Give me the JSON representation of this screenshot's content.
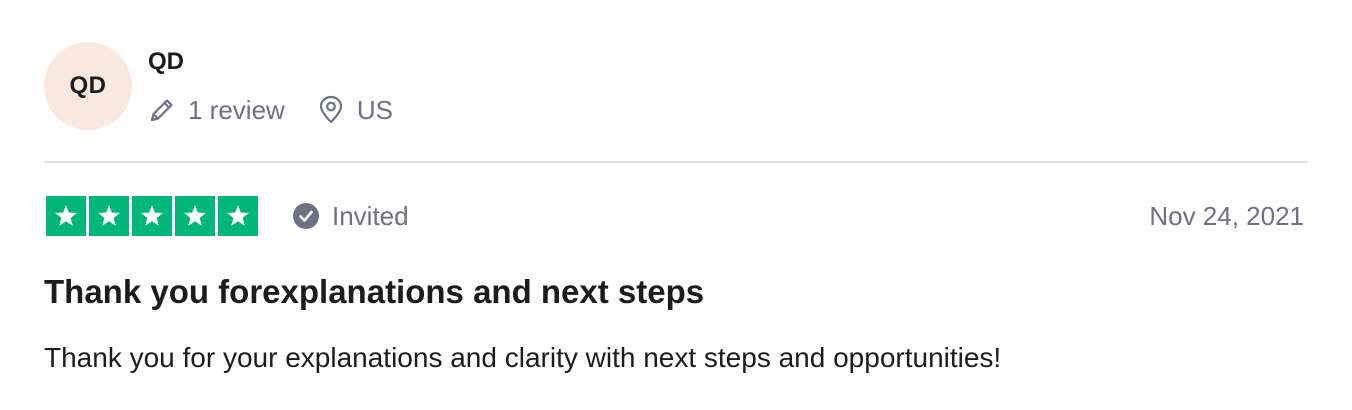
{
  "reviewer": {
    "initials": "QD",
    "name": "QD",
    "review_count": "1 review",
    "location": "US",
    "avatar_bg": "#f9e8de"
  },
  "rating": {
    "stars": 5,
    "max_stars": 5,
    "star_color": "#00b67a",
    "verification_label": "Invited"
  },
  "review": {
    "date": "Nov 24, 2021",
    "title": "Thank you forexplanations and next steps",
    "body": "Thank you for your explanations and clarity with next steps and opportunities!"
  },
  "icons": {
    "review_count": "pencil-icon",
    "location": "location-pin-icon",
    "verification": "check-circle-icon",
    "star": "star-icon"
  },
  "colors": {
    "meta_text": "#6f6f87",
    "text": "#1c1c1c",
    "divider": "#e4e4e8"
  }
}
